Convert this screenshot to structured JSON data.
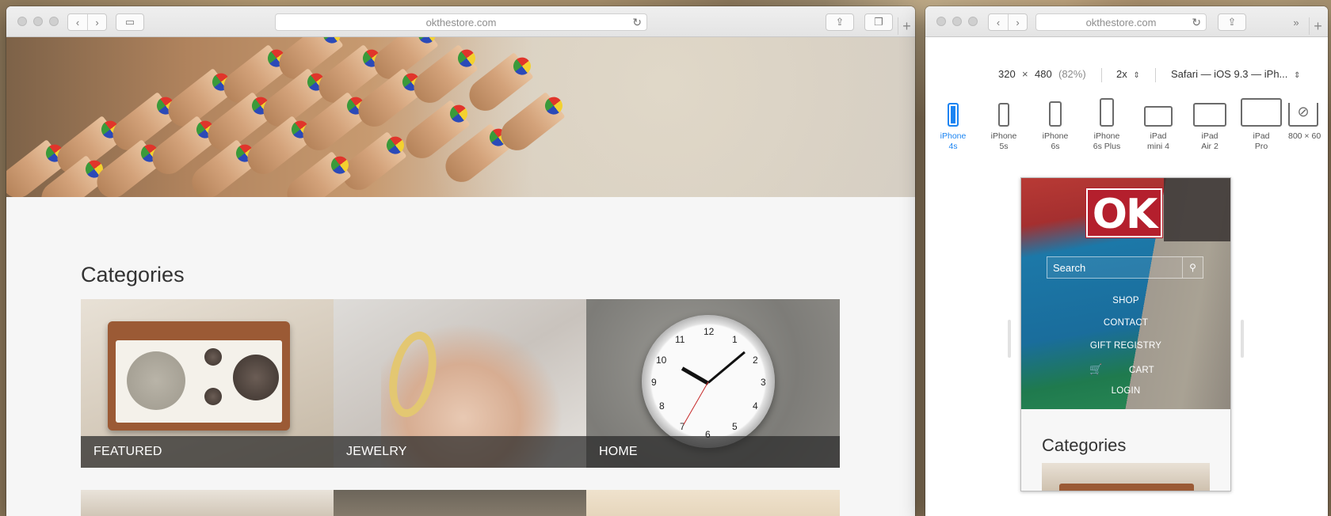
{
  "main_window": {
    "url": "okthestore.com",
    "categories_title": "Categories",
    "categories": [
      {
        "label": "FEATURED"
      },
      {
        "label": "JEWELRY"
      },
      {
        "label": "HOME"
      }
    ]
  },
  "rdm_window": {
    "url": "okthestore.com",
    "viewport": {
      "width": "320",
      "times": "×",
      "height": "480",
      "scale": "(82%)"
    },
    "pixel_ratio": "2x",
    "user_agent": "Safari — iOS 9.3 — iPh...",
    "devices": [
      {
        "line1": "iPhone",
        "line2": "4s",
        "active": true
      },
      {
        "line1": "iPhone",
        "line2": "5s"
      },
      {
        "line1": "iPhone",
        "line2": "6s"
      },
      {
        "line1": "iPhone",
        "line2": "6s Plus"
      },
      {
        "line1": "iPad",
        "line2": "mini 4"
      },
      {
        "line1": "iPad",
        "line2": "Air 2"
      },
      {
        "line1": "iPad",
        "line2": "Pro"
      },
      {
        "line1": "800 × 60",
        "line2": ""
      }
    ],
    "mobile_page": {
      "logo": "OK",
      "search_placeholder": "Search",
      "nav": [
        "SHOP",
        "CONTACT",
        "GIFT REGISTRY",
        "CART",
        "LOGIN"
      ],
      "categories_title": "Categories"
    }
  },
  "colors": {
    "accent_blue": "#1b84f2",
    "logo_red": "#b41f2d"
  },
  "icons": [
    "back-icon",
    "forward-icon",
    "sidebar-icon",
    "reload-icon",
    "share-icon",
    "tabs-icon",
    "new-tab-icon",
    "overflow-icon",
    "search-icon",
    "cart-icon",
    "compass-icon",
    "stepper-icon"
  ]
}
